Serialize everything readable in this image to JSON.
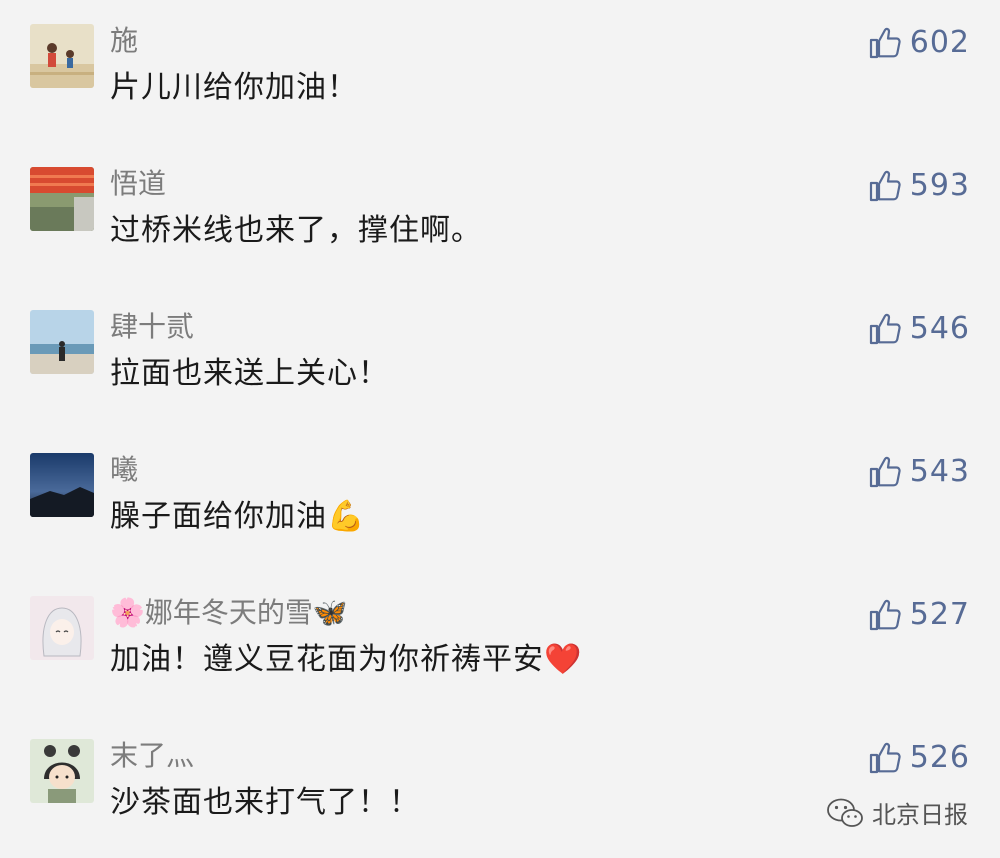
{
  "comments": [
    {
      "nickname": "施",
      "content": "片儿川给你加油！",
      "likes": "602"
    },
    {
      "nickname": "悟道",
      "content": "过桥米线也来了，撑住啊。",
      "likes": "593"
    },
    {
      "nickname": "肆十贰",
      "content": "拉面也来送上关心！",
      "likes": "546"
    },
    {
      "nickname": "曦",
      "content": "臊子面给你加油💪",
      "likes": "543"
    },
    {
      "nickname": "🌸娜年冬天的雪🦋",
      "content": "加油！遵义豆花面为你祈祷平安❤️",
      "likes": "527"
    },
    {
      "nickname": "末了灬",
      "content": "沙茶面也来打气了！！",
      "likes": "526"
    }
  ],
  "watermark": {
    "text": "北京日报",
    "icon": "wechat-icon"
  },
  "icons": {
    "like": "thumbs-up-icon"
  },
  "colors": {
    "background": "#f3f3f3",
    "like": "#576b95",
    "nickname": "#7c7c7c",
    "text": "#1a1a1a"
  }
}
